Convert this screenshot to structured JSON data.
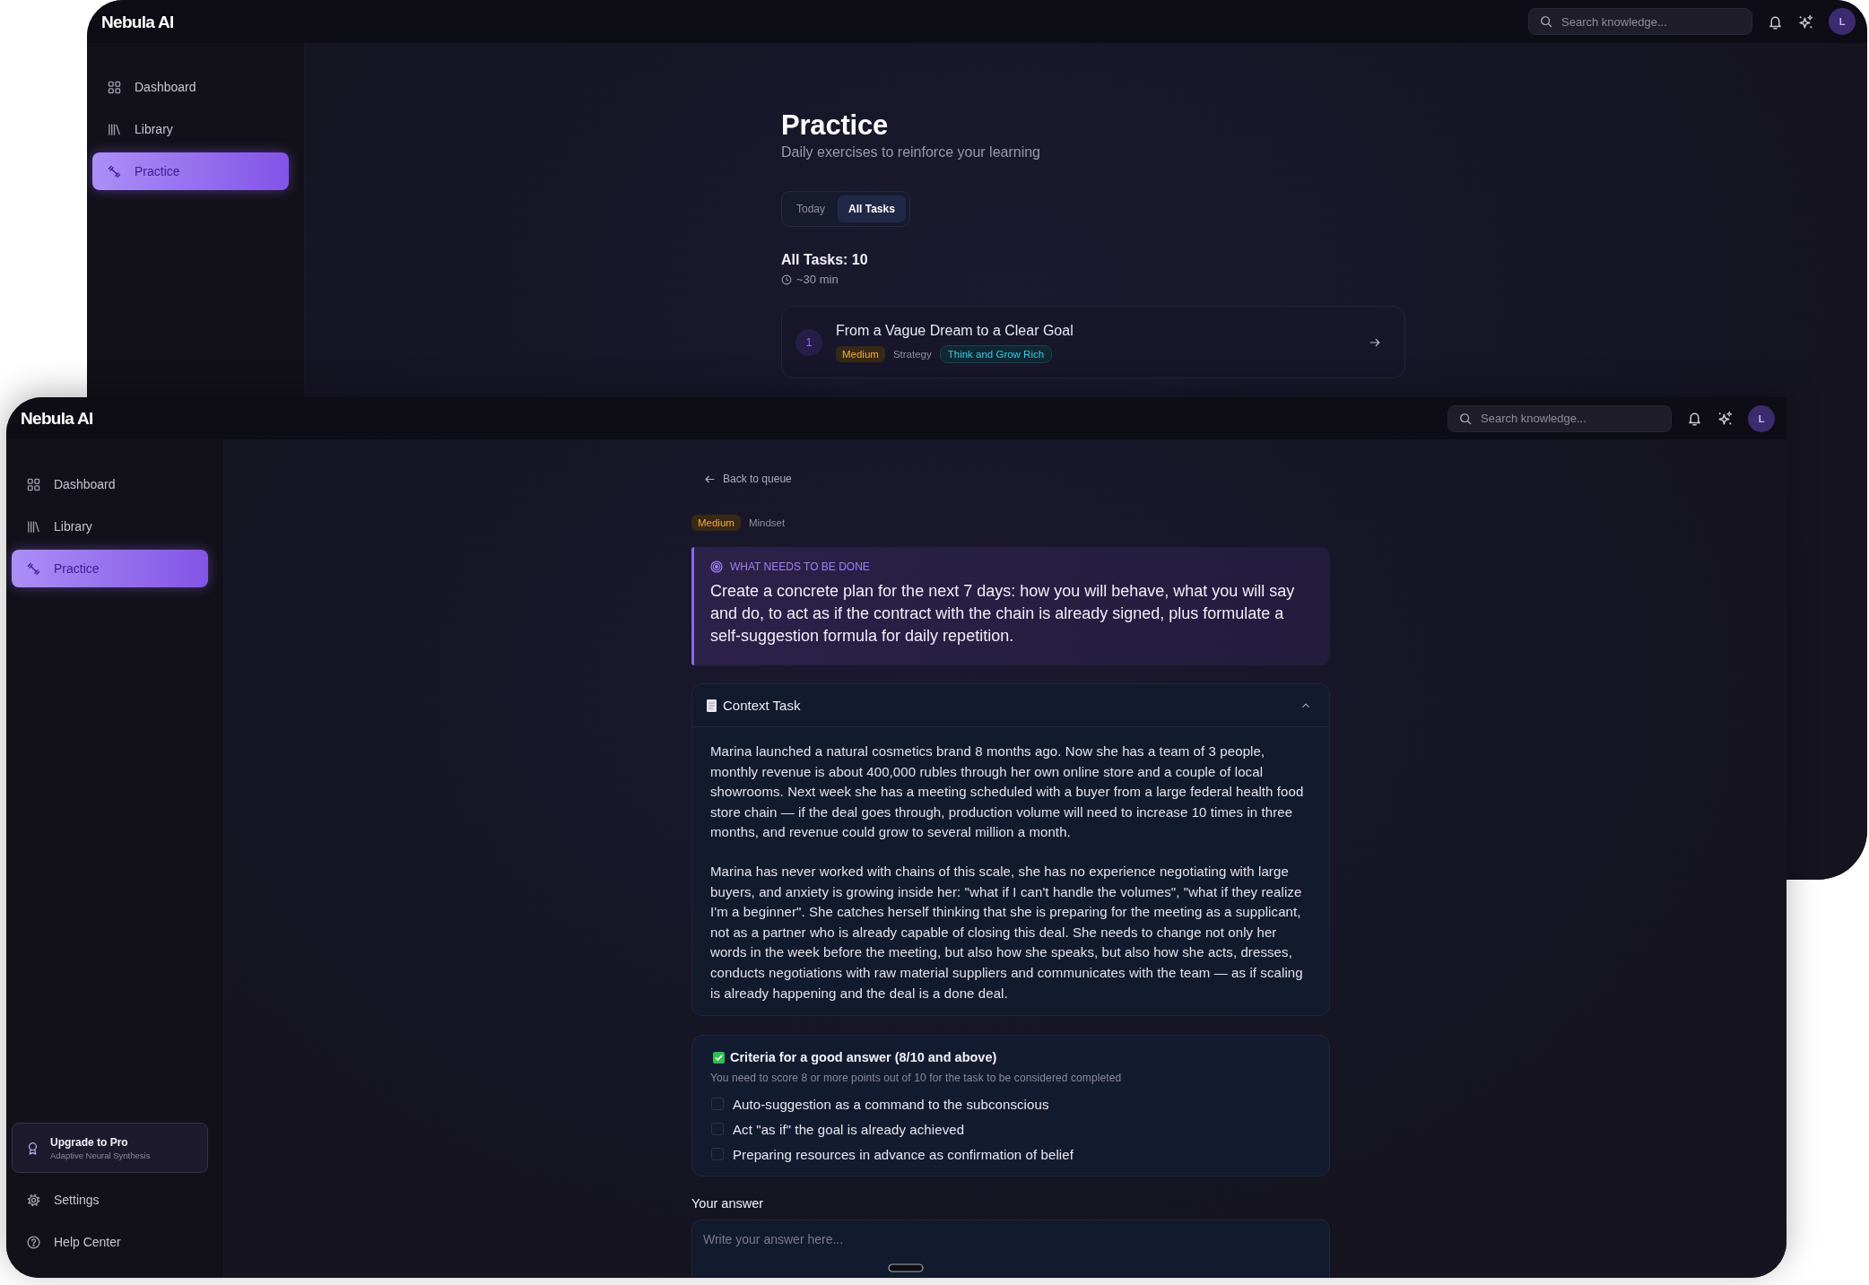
{
  "windows": [
    {
      "kind": "practice-list",
      "app_name": "Nebula AI",
      "search": {
        "placeholder": "Search knowledge..."
      },
      "avatar": "L",
      "sidebar": {
        "items": [
          {
            "label": "Dashboard",
            "selected": false
          },
          {
            "label": "Library",
            "selected": false
          },
          {
            "label": "Practice",
            "selected": true
          }
        ]
      },
      "page": {
        "title": "Practice",
        "subtitle": "Daily exercises to reinforce your learning",
        "tabs": [
          {
            "label": "Today",
            "selected": false
          },
          {
            "label": "All Tasks",
            "selected": true
          }
        ],
        "count": "All Tasks: 10",
        "duration": "~30 min",
        "tasks": [
          {
            "number": "1",
            "title": "From a Vague Dream to a Clear Goal",
            "tags": [
              {
                "label": "Medium",
                "kind": "difficulty"
              },
              {
                "label": "Strategy",
                "kind": "category"
              },
              {
                "label": "Think and Grow Rich",
                "kind": "book"
              }
            ]
          }
        ]
      }
    },
    {
      "kind": "task-detail",
      "app_name": "Nebula AI",
      "search": {
        "placeholder": "Search knowledge..."
      },
      "avatar": "L",
      "sidebar": {
        "items": [
          {
            "label": "Dashboard",
            "selected": false
          },
          {
            "label": "Library",
            "selected": false
          },
          {
            "label": "Practice",
            "selected": true
          }
        ],
        "upgrade": {
          "title": "Upgrade to Pro",
          "subtitle": "Adaptive Neural Synthesis"
        },
        "footer_items": [
          {
            "label": "Settings",
            "selected": false
          },
          {
            "label": "Help Center",
            "selected": false
          }
        ]
      },
      "page": {
        "back_link": "Back to queue",
        "tags": [
          {
            "label": "Medium",
            "kind": "difficulty"
          },
          {
            "label": "Mindset",
            "kind": "category"
          }
        ],
        "instruction": {
          "heading": "WHAT NEEDS TO BE DONE",
          "text": "Create a concrete plan for the next 7 days: how you will behave, what you will say and do, to act as if the contract with the chain is already signed, plus formulate a self-suggestion formula for daily repetition."
        },
        "context": {
          "title": "Context Task",
          "expanded": true,
          "paragraphs": [
            "Marina launched a natural cosmetics brand 8 months ago. Now she has a team of 3 people, monthly revenue is about 400,000 rubles through her own online store and a couple of local showrooms. Next week she has a meeting scheduled with a buyer from a large federal health food store chain — if the deal goes through, production volume will need to increase 10 times in three months, and revenue could grow to several million a month.",
            "Marina has never worked with chains of this scale, she has no experience negotiating with large buyers, and anxiety is growing inside her: \"what if I can't handle the volumes\", \"what if they realize I'm a beginner\". She catches herself thinking that she is preparing for the meeting as a supplicant, not as a partner who is already capable of closing this deal. She needs to change not only her words in the week before the meeting, but also how she speaks, but also how she acts, dresses, conducts negotiations with raw material suppliers and communicates with the team — as if scaling is already happening and the deal is a done deal."
          ]
        },
        "criteria": {
          "title": "Criteria for a good answer (8/10 and above)",
          "note": "You need to score 8 or more points out of 10 for the task to be considered completed",
          "items": [
            {
              "label": "Auto-suggestion as a command to the subconscious",
              "checked": false
            },
            {
              "label": "Act \"as if\" the goal is already achieved",
              "checked": false
            },
            {
              "label": "Preparing resources in advance as confirmation of belief",
              "checked": false
            }
          ]
        },
        "answer": {
          "label": "Your answer",
          "placeholder": "Write your answer here..."
        }
      }
    }
  ]
}
